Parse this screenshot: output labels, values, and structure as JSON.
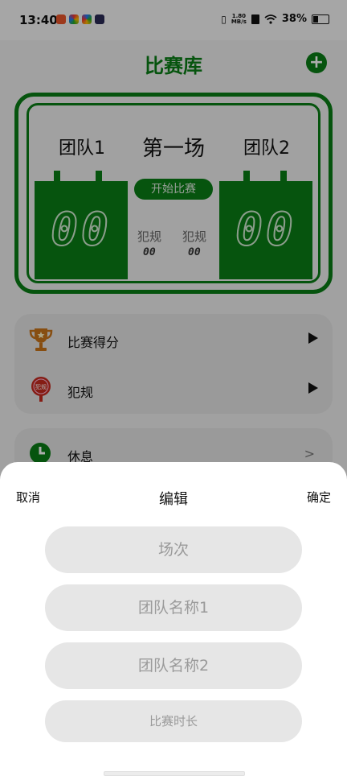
{
  "status_bar": {
    "time": "13:40",
    "net_speed_value": "1.80",
    "net_speed_unit": "MB/s",
    "battery": "38%",
    "icons": [
      "app-notification-icon",
      "vibrate-icon",
      "wifi-icon",
      "battery-icon"
    ]
  },
  "app_bar": {
    "title": "比赛库",
    "add_icon": "+"
  },
  "scoreboard": {
    "team1": "团队1",
    "match": "第一场",
    "team2": "团队2",
    "score1": "00",
    "score2": "00",
    "start_label": "开始比赛",
    "foul_label_1": "犯规",
    "foul_label_2": "犯规",
    "foul1": "00",
    "foul2": "00"
  },
  "menu": {
    "items": [
      {
        "label": "比赛得分",
        "icon": "trophy-icon"
      },
      {
        "label": "犯规",
        "icon": "whistle-icon"
      },
      {
        "label": "休息",
        "icon": "clock-icon"
      }
    ]
  },
  "sheet": {
    "cancel": "取消",
    "title": "编辑",
    "confirm": "确定",
    "fields": {
      "round_placeholder": "场次",
      "team1_placeholder": "团队名称1",
      "team2_placeholder": "团队名称2",
      "duration_placeholder": "比赛时长"
    }
  },
  "colors": {
    "accent": "#0a7d16",
    "sheet_bg": "#ffffff",
    "field_bg": "#e6e6e6"
  }
}
